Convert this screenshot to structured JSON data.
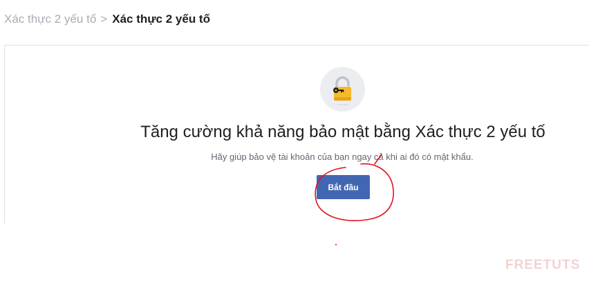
{
  "breadcrumb": {
    "parent": "Xác thực 2 yếu tố",
    "separator": ">",
    "current": "Xác thực 2 yếu tố"
  },
  "main": {
    "icon": "lock-key-icon",
    "heading": "Tăng cường khả năng bảo mật bằng Xác thực 2 yếu tố",
    "subtext": "Hãy giúp bảo vệ tài khoản của bạn ngay cả khi ai đó có mật khẩu.",
    "start_button_label": "Bắt đầu"
  },
  "watermark": "FREETUTS",
  "colors": {
    "primary_button": "#4267b2",
    "annotation": "#e0111b",
    "lock": "#f7b928"
  }
}
